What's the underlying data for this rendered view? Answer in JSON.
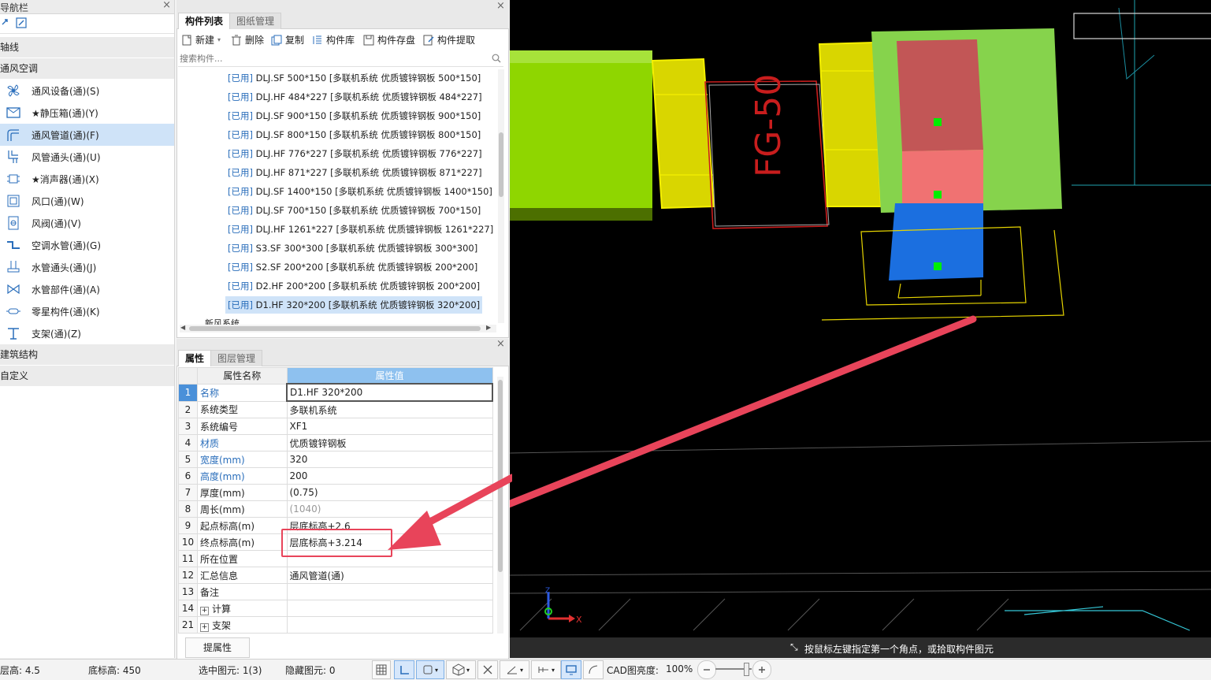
{
  "nav": {
    "title": "导航栏",
    "groups": {
      "axis": "轴线",
      "hvac": "通风空调",
      "building": "建筑结构",
      "custom": "自定义"
    },
    "items": [
      {
        "label": "通风设备(通)(S)",
        "icon": "fan-icon"
      },
      {
        "label": "★静压箱(通)(Y)",
        "icon": "box-icon"
      },
      {
        "label": "通风管道(通)(F)",
        "icon": "duct-icon"
      },
      {
        "label": "风管通头(通)(U)",
        "icon": "duct-fitting-icon"
      },
      {
        "label": "★消声器(通)(X)",
        "icon": "silencer-icon"
      },
      {
        "label": "风口(通)(W)",
        "icon": "air-outlet-icon"
      },
      {
        "label": "风阀(通)(V)",
        "icon": "damper-icon"
      },
      {
        "label": "空调水管(通)(G)",
        "icon": "water-pipe-icon"
      },
      {
        "label": "水管通头(通)(J)",
        "icon": "pipe-fitting-icon"
      },
      {
        "label": "水管部件(通)(A)",
        "icon": "valve-icon"
      },
      {
        "label": "零星构件(通)(K)",
        "icon": "misc-icon"
      },
      {
        "label": "支架(通)(Z)",
        "icon": "bracket-icon"
      }
    ],
    "selected_index": 2
  },
  "component_list": {
    "tabs": [
      "构件列表",
      "图纸管理"
    ],
    "toolbar": {
      "new": "新建",
      "delete": "删除",
      "copy": "复制",
      "library": "构件库",
      "save": "构件存盘",
      "extract": "构件提取"
    },
    "search_placeholder": "搜索构件...",
    "rows": [
      {
        "status": "[已用]",
        "name": "DLJ.SF 500*150 [多联机系统 优质镀锌钢板 500*150]"
      },
      {
        "status": "[已用]",
        "name": "DLJ.HF 484*227 [多联机系统 优质镀锌钢板 484*227]"
      },
      {
        "status": "[已用]",
        "name": "DLJ.SF 900*150 [多联机系统 优质镀锌钢板 900*150]"
      },
      {
        "status": "[已用]",
        "name": "DLJ.SF 800*150 [多联机系统 优质镀锌钢板 800*150]"
      },
      {
        "status": "[已用]",
        "name": "DLJ.HF 776*227 [多联机系统 优质镀锌钢板 776*227]"
      },
      {
        "status": "[已用]",
        "name": "DLJ.HF 871*227 [多联机系统 优质镀锌钢板 871*227]"
      },
      {
        "status": "[已用]",
        "name": "DLJ.SF 1400*150 [多联机系统 优质镀锌钢板 1400*150]"
      },
      {
        "status": "[已用]",
        "name": "DLJ.SF 700*150 [多联机系统 优质镀锌钢板 700*150]"
      },
      {
        "status": "[已用]",
        "name": "DLJ.HF 1261*227 [多联机系统 优质镀锌钢板 1261*227]"
      },
      {
        "status": "[已用]",
        "name": "S3.SF 300*300 [多联机系统 优质镀锌钢板 300*300]"
      },
      {
        "status": "[已用]",
        "name": "S2.SF 200*200 [多联机系统 优质镀锌钢板 200*200]"
      },
      {
        "status": "[已用]",
        "name": "D2.HF 200*200 [多联机系统 优质镀锌钢板 200*200]"
      },
      {
        "status": "[已用]",
        "name": "D1.HF 320*200 [多联机系统 优质镀锌钢板 320*200]"
      }
    ],
    "selected_index": 12,
    "partial_row": "新风系统"
  },
  "properties": {
    "tabs": [
      "属性",
      "图层管理"
    ],
    "header": {
      "name": "属性名称",
      "value": "属性值"
    },
    "rows": [
      {
        "no": "1",
        "name": "名称",
        "value": "D1.HF 320*200"
      },
      {
        "no": "2",
        "name": "系统类型",
        "value": "多联机系统"
      },
      {
        "no": "3",
        "name": "系统编号",
        "value": "XF1"
      },
      {
        "no": "4",
        "name": "材质",
        "value": "优质镀锌钢板"
      },
      {
        "no": "5",
        "name": "宽度(mm)",
        "value": "320"
      },
      {
        "no": "6",
        "name": "高度(mm)",
        "value": "200"
      },
      {
        "no": "7",
        "name": "厚度(mm)",
        "value": "(0.75)"
      },
      {
        "no": "8",
        "name": "周长(mm)",
        "value": "(1040)"
      },
      {
        "no": "9",
        "name": "起点标高(m)",
        "value": "层底标高+2.6"
      },
      {
        "no": "10",
        "name": "终点标高(m)",
        "value": "层底标高+3.214"
      },
      {
        "no": "11",
        "name": "所在位置",
        "value": ""
      },
      {
        "no": "12",
        "name": "汇总信息",
        "value": "通风管道(通)"
      },
      {
        "no": "13",
        "name": "备注",
        "value": ""
      },
      {
        "no": "14",
        "name": "计算",
        "value": ""
      },
      {
        "no": "21",
        "name": "支架",
        "value": ""
      }
    ],
    "extract_button": "提属性"
  },
  "status_bar": {
    "floor_height": "层高: 4.5",
    "base_elev": "底标高: 450",
    "selected": "选中图元: 1(3)",
    "hidden": "隐藏图元: 0",
    "cad_brightness_label": "CAD图亮度:",
    "cad_brightness": "100%"
  },
  "viewport": {
    "hint": "按鼠标左键指定第一个角点，或拾取构件图元",
    "damper_label": "FG-50",
    "axis_x": "X",
    "axis_z": "Z"
  },
  "colors": {
    "accent_blue": "#2a6ebb",
    "selection": "#cfe3f8",
    "header_blue": "#8ec1ef",
    "highlight_red": "#e8445a",
    "duct_green": "#8fd600",
    "duct_yellow": "#d9d600"
  }
}
